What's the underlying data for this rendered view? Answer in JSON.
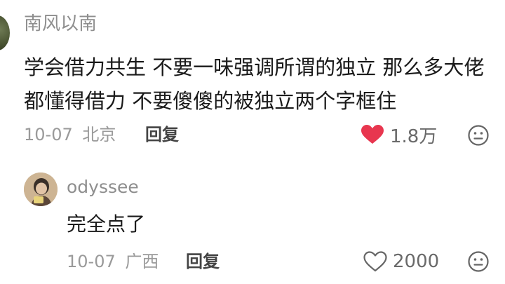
{
  "comment": {
    "author": "南风以南",
    "text": "学会借力共生 不要一味强调所谓的独立 那么多大佬都懂得借力 不要傻傻的被独立两个字框住",
    "date": "10-07",
    "location": "北京",
    "reply_label": "回复",
    "likes": "1.8万",
    "liked": true,
    "like_color": "#e8364f"
  },
  "reply": {
    "author": "odyssee",
    "text": "完全点了",
    "date": "10-07",
    "location": "广西",
    "reply_label": "回复",
    "likes": "2000",
    "liked": false
  },
  "icons": {
    "like_filled": "heart-filled-icon",
    "like_outline": "heart-outline-icon",
    "emoji": "emoji-face-icon"
  }
}
